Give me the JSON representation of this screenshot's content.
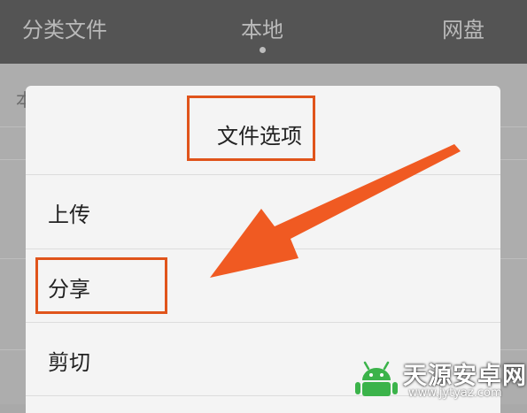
{
  "header": {
    "tabs": [
      {
        "label": "分类文件"
      },
      {
        "label": "本地",
        "active": true
      },
      {
        "label": "网盘"
      }
    ]
  },
  "background_list": {
    "first_char": "本"
  },
  "dialog": {
    "title": "文件选项",
    "options": [
      {
        "label": "上传"
      },
      {
        "label": "分享",
        "highlighted": true
      },
      {
        "label": "剪切"
      }
    ]
  },
  "colors": {
    "highlight": "#e0541b",
    "arrow": "#f05a22",
    "header_bg": "#545454"
  },
  "watermark": {
    "name": "天源安卓网",
    "url": "www.jytyaz.com",
    "logo": "android-logo"
  }
}
